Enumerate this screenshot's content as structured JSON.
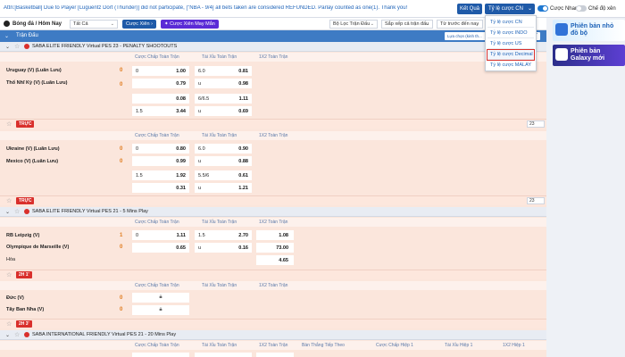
{
  "topbar": {
    "announce": "Attn:[Basketball] Due to Player [Luguentz Dort (Thunder)] did not participate, [\"NBA - 9/4] all bets taken are considered REFUNDED. Parlay counted as one(1). Thank you!",
    "ketqua_label": "Kết Quả",
    "odds_type_label": "Tỷ lệ cược CN",
    "toggle1_label": "Cược Nhanh",
    "toggle2_label": "Chế độ xên"
  },
  "filters": {
    "sport_label": "Bóng đá / Hôm Nay",
    "select_all": "Tất Cả",
    "btn_xien": "Cược Xiên",
    "btn_xien_may_man": "Cược Xiên May Mắn",
    "bo_loc": "Bộ Lọc Trận Đấu",
    "sap_xep": "Sắp xếp cả trận đấu",
    "tu_truoc": "Từ trước đến nay"
  },
  "dropdown": {
    "items": [
      "Tỷ lệ cược CN",
      "Tỷ lệ cược INDO",
      "Tỷ lệ cược US",
      "Tỷ lệ cược Decimal",
      "Tỷ lệ cược MALAY"
    ]
  },
  "main": {
    "header_label": "Trận Đấu",
    "filter_button": "Lựa chọn (kinh th...",
    "cols": {
      "handicap": "Cược Chấp Toàn Trận",
      "taixiu": "Tài Xỉu Toàn Trận",
      "x12": "1X2 Toàn Trận",
      "bantiep": "Bàn Thắng Tiếp Theo",
      "chap_h1": "Cược Chấp Hiệp 1",
      "taixiu_h1": "Tài Xỉu Hiệp 1",
      "x12_h1": "1X2 Hiệp 1"
    },
    "leagues": [
      "SABA ELITE FRIENDLY Virtual PES 23 - PENALTY SHOOTOUTS",
      "SABA ELITE FRIENDLY Virtual PES 21 - 5 Mins Play",
      "SABA INTERNATIONAL FRIENDLY Virtual PES 21 - 20 Mins Play"
    ],
    "m1": {
      "team1": "Uruguay (V) (Luân Lưu)",
      "score1": "0",
      "team2": "Thổ Nhĩ Kỳ (V) (Luân Lưu)",
      "score2": "0",
      "r1": [
        "0",
        "1.00",
        "6.0",
        "0.81"
      ],
      "r2": [
        "",
        "0.79",
        "u",
        "0.98"
      ],
      "r3": [
        "",
        "0.08",
        "6/6.5",
        "1.11"
      ],
      "r4": [
        "1.5",
        "3.44",
        "u",
        "0.69"
      ]
    },
    "live1": "TRỰC",
    "m2": {
      "team1": "Ukraine (V) (Luân Lưu)",
      "score1": "0",
      "team2": "Mexico (V) (Luân Lưu)",
      "score2": "0",
      "r1": [
        "0",
        "0.80",
        "6.0",
        "0.90"
      ],
      "r2": [
        "",
        "0.99",
        "u",
        "0.88"
      ],
      "r3": [
        "1.5",
        "1.92",
        "5.5/6",
        "0.61"
      ],
      "r4": [
        "",
        "0.31",
        "u",
        "1.21"
      ]
    },
    "live2": "TRỰC",
    "pager": "23",
    "m3": {
      "team1": "RB Leipzig (V)",
      "score1": "1",
      "team2": "Olympique de Marseille (V)",
      "score2": "0",
      "draw": "Hòa",
      "r1": [
        "0",
        "1.11",
        "1.5",
        "2.70",
        "1.08"
      ],
      "r2": [
        "",
        "0.65",
        "u",
        "0.16",
        "73.00"
      ],
      "r3": [
        "4.65"
      ]
    },
    "live3": "2H 1'",
    "m4": {
      "team1": "Đức (V)",
      "score1": "0",
      "team2": "Tây Ban Nha (V)",
      "score2": "0"
    },
    "live4": "2H 3'"
  },
  "ads": {
    "ad1_text": "Phiên bản nhỏ đồ bộ",
    "ad2_text": "Phiên bản Galaxy mới"
  },
  "colors": {
    "primary": "#1f5aa8",
    "header": "#3e7bc4",
    "odds_bg": "#fbe6dc",
    "live": "#d9302c",
    "accent": "#5b2bd6"
  }
}
